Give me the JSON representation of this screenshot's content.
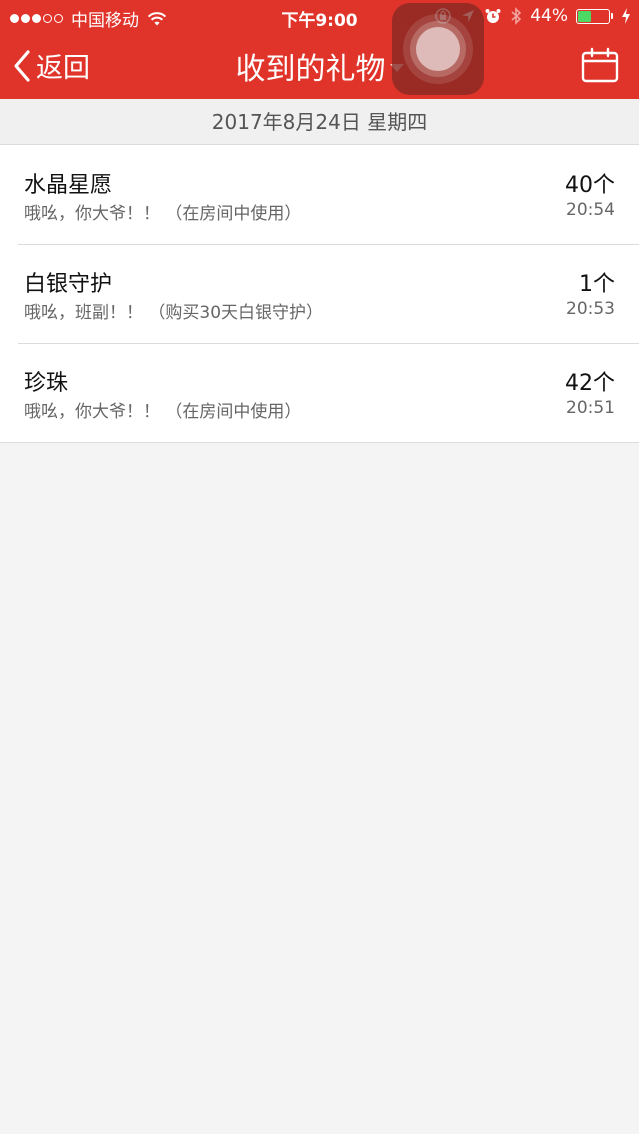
{
  "status_bar": {
    "carrier": "中国移动",
    "time": "下午9:00",
    "battery_text": "44%",
    "battery_level": 0.44,
    "signal_bars_filled": 3,
    "signal_bars_total": 5,
    "icons": [
      "wifi-icon",
      "rotation-lock-icon",
      "location-icon",
      "alarm-icon",
      "bluetooth-icon",
      "charging-icon"
    ]
  },
  "nav": {
    "back_label": "返回",
    "title": "收到的礼物",
    "calendar_icon": "calendar-icon"
  },
  "colors": {
    "header_bg": "#e0342b",
    "page_bg": "#f4f4f4",
    "battery_fill": "#4cd964"
  },
  "date_header": "2017年8月24日 星期四",
  "gifts": [
    {
      "name": "水晶星愿",
      "message": "哦吆，你大爷！！  （在房间中使用）",
      "count": "40个",
      "time": "20:54"
    },
    {
      "name": "白银守护",
      "message": "哦吆，班副！！  （购买30天白银守护）",
      "count": "1个",
      "time": "20:53"
    },
    {
      "name": "珍珠",
      "message": "哦吆，你大爷！！  （在房间中使用）",
      "count": "42个",
      "time": "20:51"
    }
  ]
}
